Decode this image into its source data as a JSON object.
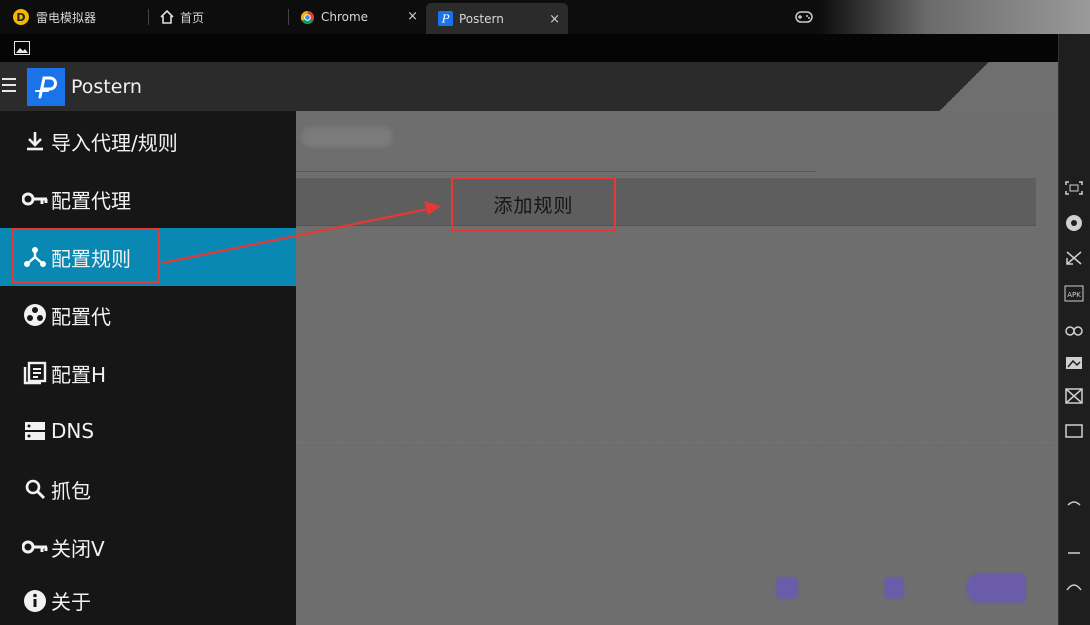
{
  "tabs": [
    {
      "label": "雷电模拟器",
      "icon": "leidian-logo-icon"
    },
    {
      "label": "首页",
      "icon": "home-icon"
    },
    {
      "label": "Chrome",
      "icon": "chrome-icon",
      "close": "×"
    },
    {
      "label": "Postern",
      "icon": "postern-icon",
      "close": "×",
      "active": true
    }
  ],
  "app": {
    "title": "Postern"
  },
  "drawer": {
    "items": [
      {
        "label": "导入代理/规则",
        "icon": "download-icon"
      },
      {
        "label": "配置代理",
        "icon": "key-icon"
      },
      {
        "label": "配置规则",
        "icon": "share-icon",
        "active": true
      },
      {
        "label": "配置代",
        "icon": "dots-icon"
      },
      {
        "label": "配置H",
        "icon": "list-icon"
      },
      {
        "label": "DNS",
        "icon": "server-icon"
      },
      {
        "label": "抓包",
        "icon": "search-icon"
      },
      {
        "label": "关闭V",
        "icon": "key-icon"
      },
      {
        "label": "关于",
        "icon": "info-icon"
      }
    ]
  },
  "main": {
    "add_rule_label": "添加规则"
  },
  "colors": {
    "accent": "#0a88b4",
    "highlight": "#e53935",
    "brand": "#1a73e8"
  },
  "sidebar_icons": [
    "fullscreen-icon",
    "volume-icon",
    "shrink-icon",
    "apk-icon",
    "link-icon",
    "screenshot-icon",
    "multi-icon",
    "screen-icon",
    "back-icon",
    "home-icon",
    "recent-icon"
  ]
}
